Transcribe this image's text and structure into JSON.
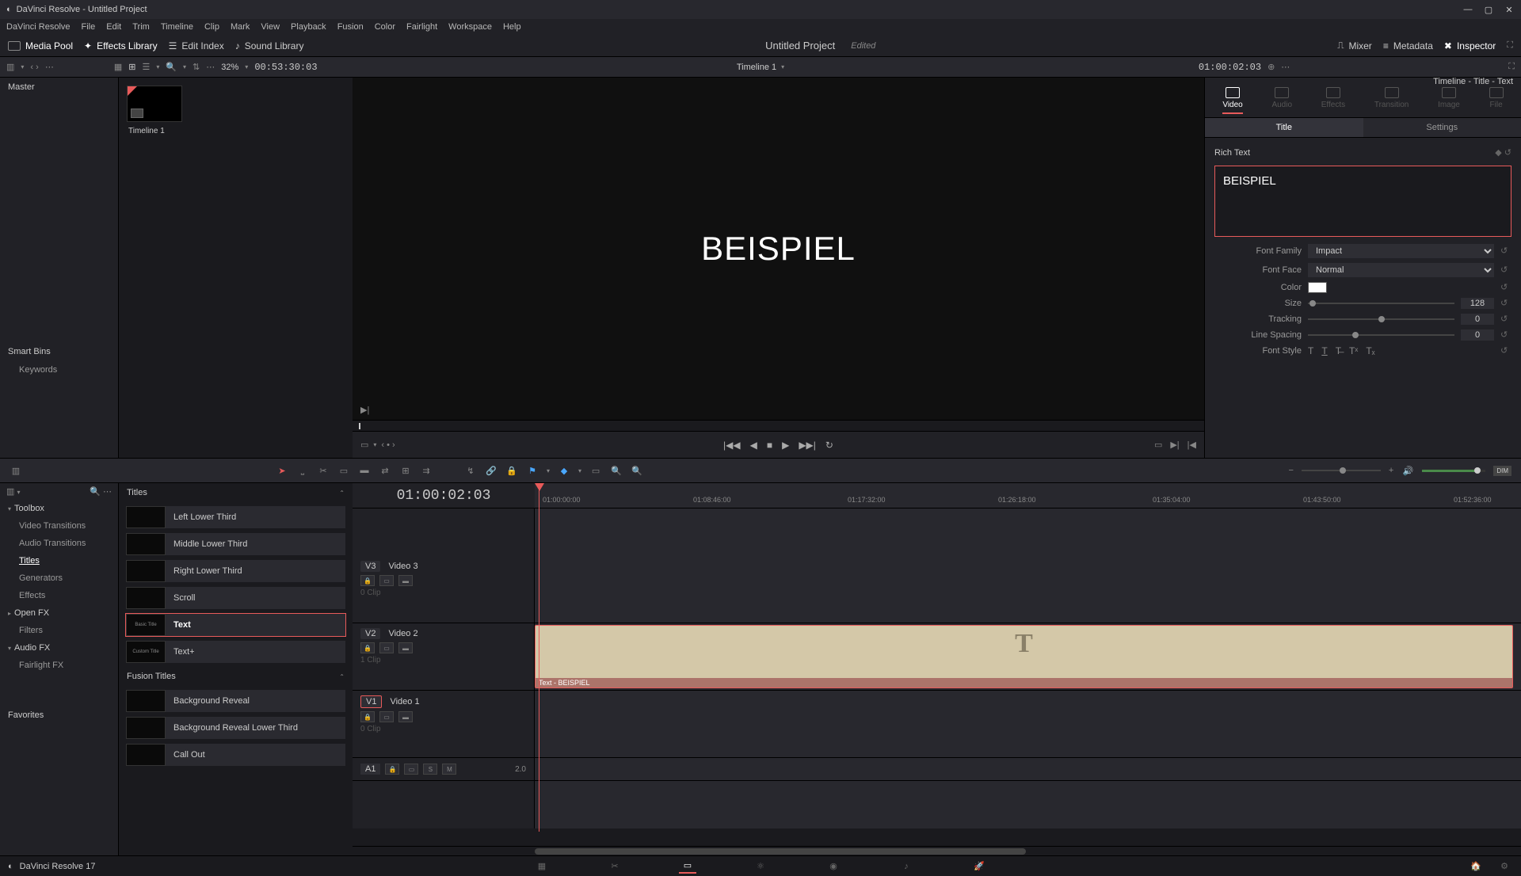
{
  "app": {
    "title": "DaVinci Resolve - Untitled Project"
  },
  "menu": [
    "DaVinci Resolve",
    "File",
    "Edit",
    "Trim",
    "Timeline",
    "Clip",
    "Mark",
    "View",
    "Playback",
    "Fusion",
    "Color",
    "Fairlight",
    "Workspace",
    "Help"
  ],
  "toolbar": {
    "media_pool": "Media Pool",
    "effects_library": "Effects Library",
    "edit_index": "Edit Index",
    "sound_library": "Sound Library",
    "mixer": "Mixer",
    "metadata": "Metadata",
    "inspector": "Inspector"
  },
  "project": {
    "title": "Untitled Project",
    "status": "Edited"
  },
  "subbar": {
    "zoom": "32%",
    "source_tc": "00:53:30:03",
    "timeline_name": "Timeline 1",
    "record_tc": "01:00:02:03"
  },
  "mediapool": {
    "master": "Master",
    "smart_bins": "Smart Bins",
    "keywords": "Keywords",
    "clip": "Timeline 1"
  },
  "viewer": {
    "text": "BEISPIEL"
  },
  "inspector": {
    "header": "Timeline - Title - Text",
    "tabs": [
      "Video",
      "Audio",
      "Effects",
      "Transition",
      "Image",
      "File"
    ],
    "subtabs": [
      "Title",
      "Settings"
    ],
    "section": "Rich Text",
    "text_value": "BEISPIEL",
    "font_family_label": "Font Family",
    "font_family": "Impact",
    "font_face_label": "Font Face",
    "font_face": "Normal",
    "color_label": "Color",
    "size_label": "Size",
    "size": "128",
    "tracking_label": "Tracking",
    "tracking": "0",
    "line_spacing_label": "Line Spacing",
    "line_spacing": "0",
    "font_style_label": "Font Style"
  },
  "fx": {
    "toolbox": "Toolbox",
    "items": [
      "Video Transitions",
      "Audio Transitions",
      "Titles",
      "Generators",
      "Effects"
    ],
    "openfx": "Open FX",
    "filters": "Filters",
    "audiofx": "Audio FX",
    "fairlight": "Fairlight FX",
    "favorites": "Favorites"
  },
  "titles": {
    "header": "Titles",
    "items": [
      {
        "thumb": "",
        "label": "Left Lower Third"
      },
      {
        "thumb": "",
        "label": "Middle Lower Third"
      },
      {
        "thumb": "",
        "label": "Right Lower Third"
      },
      {
        "thumb": "",
        "label": "Scroll"
      },
      {
        "thumb": "Basic Title",
        "label": "Text"
      },
      {
        "thumb": "Custom Title",
        "label": "Text+"
      }
    ],
    "fusion_header": "Fusion Titles",
    "fusion_items": [
      {
        "label": "Background Reveal"
      },
      {
        "label": "Background Reveal Lower Third"
      },
      {
        "label": "Call Out"
      }
    ]
  },
  "timeline": {
    "tc": "01:00:02:03",
    "ticks": [
      "01:00:00:00",
      "01:08:46:00",
      "01:17:32:00",
      "01:26:18:00",
      "01:35:04:00",
      "01:43:50:00",
      "01:52:36:00"
    ],
    "tracks": {
      "v3": {
        "tag": "V3",
        "name": "Video 3",
        "clips": "0 Clip"
      },
      "v2": {
        "tag": "V2",
        "name": "Video 2",
        "clips": "1 Clip"
      },
      "v1": {
        "tag": "V1",
        "name": "Video 1",
        "clips": "0 Clip"
      },
      "a1": {
        "tag": "A1",
        "meter": "2.0"
      }
    },
    "clip_label": "Text - BEISPIEL"
  },
  "bottom": {
    "app": "DaVinci Resolve 17"
  },
  "dim": "DIM"
}
